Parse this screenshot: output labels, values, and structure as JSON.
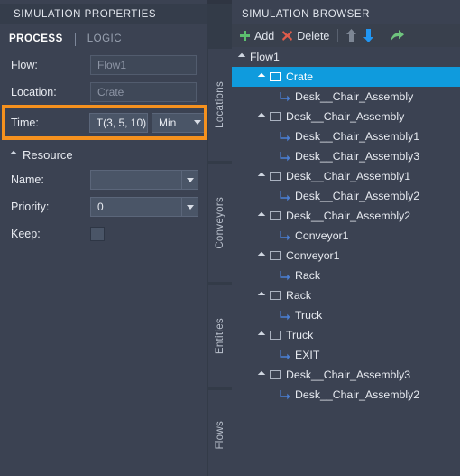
{
  "properties_panel": {
    "title": "SIMULATION PROPERTIES",
    "tabs": [
      {
        "label": "PROCESS",
        "active": true
      },
      {
        "label": "LOGIC",
        "active": false
      }
    ],
    "fields": {
      "flow": {
        "label": "Flow:",
        "value": "Flow1"
      },
      "location": {
        "label": "Location:",
        "value": "Crate"
      },
      "time": {
        "label": "Time:",
        "value": "T(3, 5, 10)",
        "unit": "Min"
      }
    },
    "resource_section": {
      "label": "Resource",
      "name": {
        "label": "Name:",
        "value": ""
      },
      "priority": {
        "label": "Priority:",
        "value": "0"
      },
      "keep": {
        "label": "Keep:",
        "checked": false
      }
    },
    "highlight_color": "#f5911e"
  },
  "vertical_tabs": [
    {
      "label": "Locations"
    },
    {
      "label": "Conveyors"
    },
    {
      "label": "Entities"
    },
    {
      "label": "Flows"
    }
  ],
  "browser_panel": {
    "title": "SIMULATION BROWSER",
    "toolbar": [
      {
        "name": "add",
        "label": "Add",
        "icon": "plus-icon",
        "color": "#5cbf6e"
      },
      {
        "name": "delete",
        "label": "Delete",
        "icon": "x-icon",
        "color": "#e05c4b"
      },
      {
        "name": "move-up",
        "label": "",
        "icon": "arrow-up-icon",
        "color": "#7d8694"
      },
      {
        "name": "move-down",
        "label": "",
        "icon": "arrow-down-icon",
        "color": "#2196f3"
      },
      {
        "name": "forward",
        "label": "",
        "icon": "curved-arrow-right-icon",
        "color": "#6fc47e"
      }
    ],
    "selection_color": "#0f9bdd",
    "tree": [
      {
        "label": "Flow1",
        "indent": 0,
        "icon": "expander",
        "selected": false
      },
      {
        "label": "Crate",
        "indent": 1,
        "icon": "node",
        "selected": true
      },
      {
        "label": "Desk__Chair_Assembly",
        "indent": 2,
        "icon": "link",
        "selected": false
      },
      {
        "label": "Desk__Chair_Assembly",
        "indent": 1,
        "icon": "node",
        "selected": false
      },
      {
        "label": "Desk__Chair_Assembly1",
        "indent": 2,
        "icon": "link",
        "selected": false
      },
      {
        "label": "Desk__Chair_Assembly3",
        "indent": 2,
        "icon": "link",
        "selected": false
      },
      {
        "label": "Desk__Chair_Assembly1",
        "indent": 1,
        "icon": "node",
        "selected": false
      },
      {
        "label": "Desk__Chair_Assembly2",
        "indent": 2,
        "icon": "link",
        "selected": false
      },
      {
        "label": "Desk__Chair_Assembly2",
        "indent": 1,
        "icon": "node",
        "selected": false
      },
      {
        "label": "Conveyor1",
        "indent": 2,
        "icon": "link",
        "selected": false
      },
      {
        "label": "Conveyor1",
        "indent": 1,
        "icon": "node",
        "selected": false
      },
      {
        "label": "Rack",
        "indent": 2,
        "icon": "link",
        "selected": false
      },
      {
        "label": "Rack",
        "indent": 1,
        "icon": "node",
        "selected": false
      },
      {
        "label": "Truck",
        "indent": 2,
        "icon": "link",
        "selected": false
      },
      {
        "label": "Truck",
        "indent": 1,
        "icon": "node",
        "selected": false
      },
      {
        "label": "EXIT",
        "indent": 2,
        "icon": "link",
        "selected": false
      },
      {
        "label": "Desk__Chair_Assembly3",
        "indent": 1,
        "icon": "node",
        "selected": false
      },
      {
        "label": "Desk__Chair_Assembly2",
        "indent": 2,
        "icon": "link",
        "selected": false
      }
    ]
  }
}
